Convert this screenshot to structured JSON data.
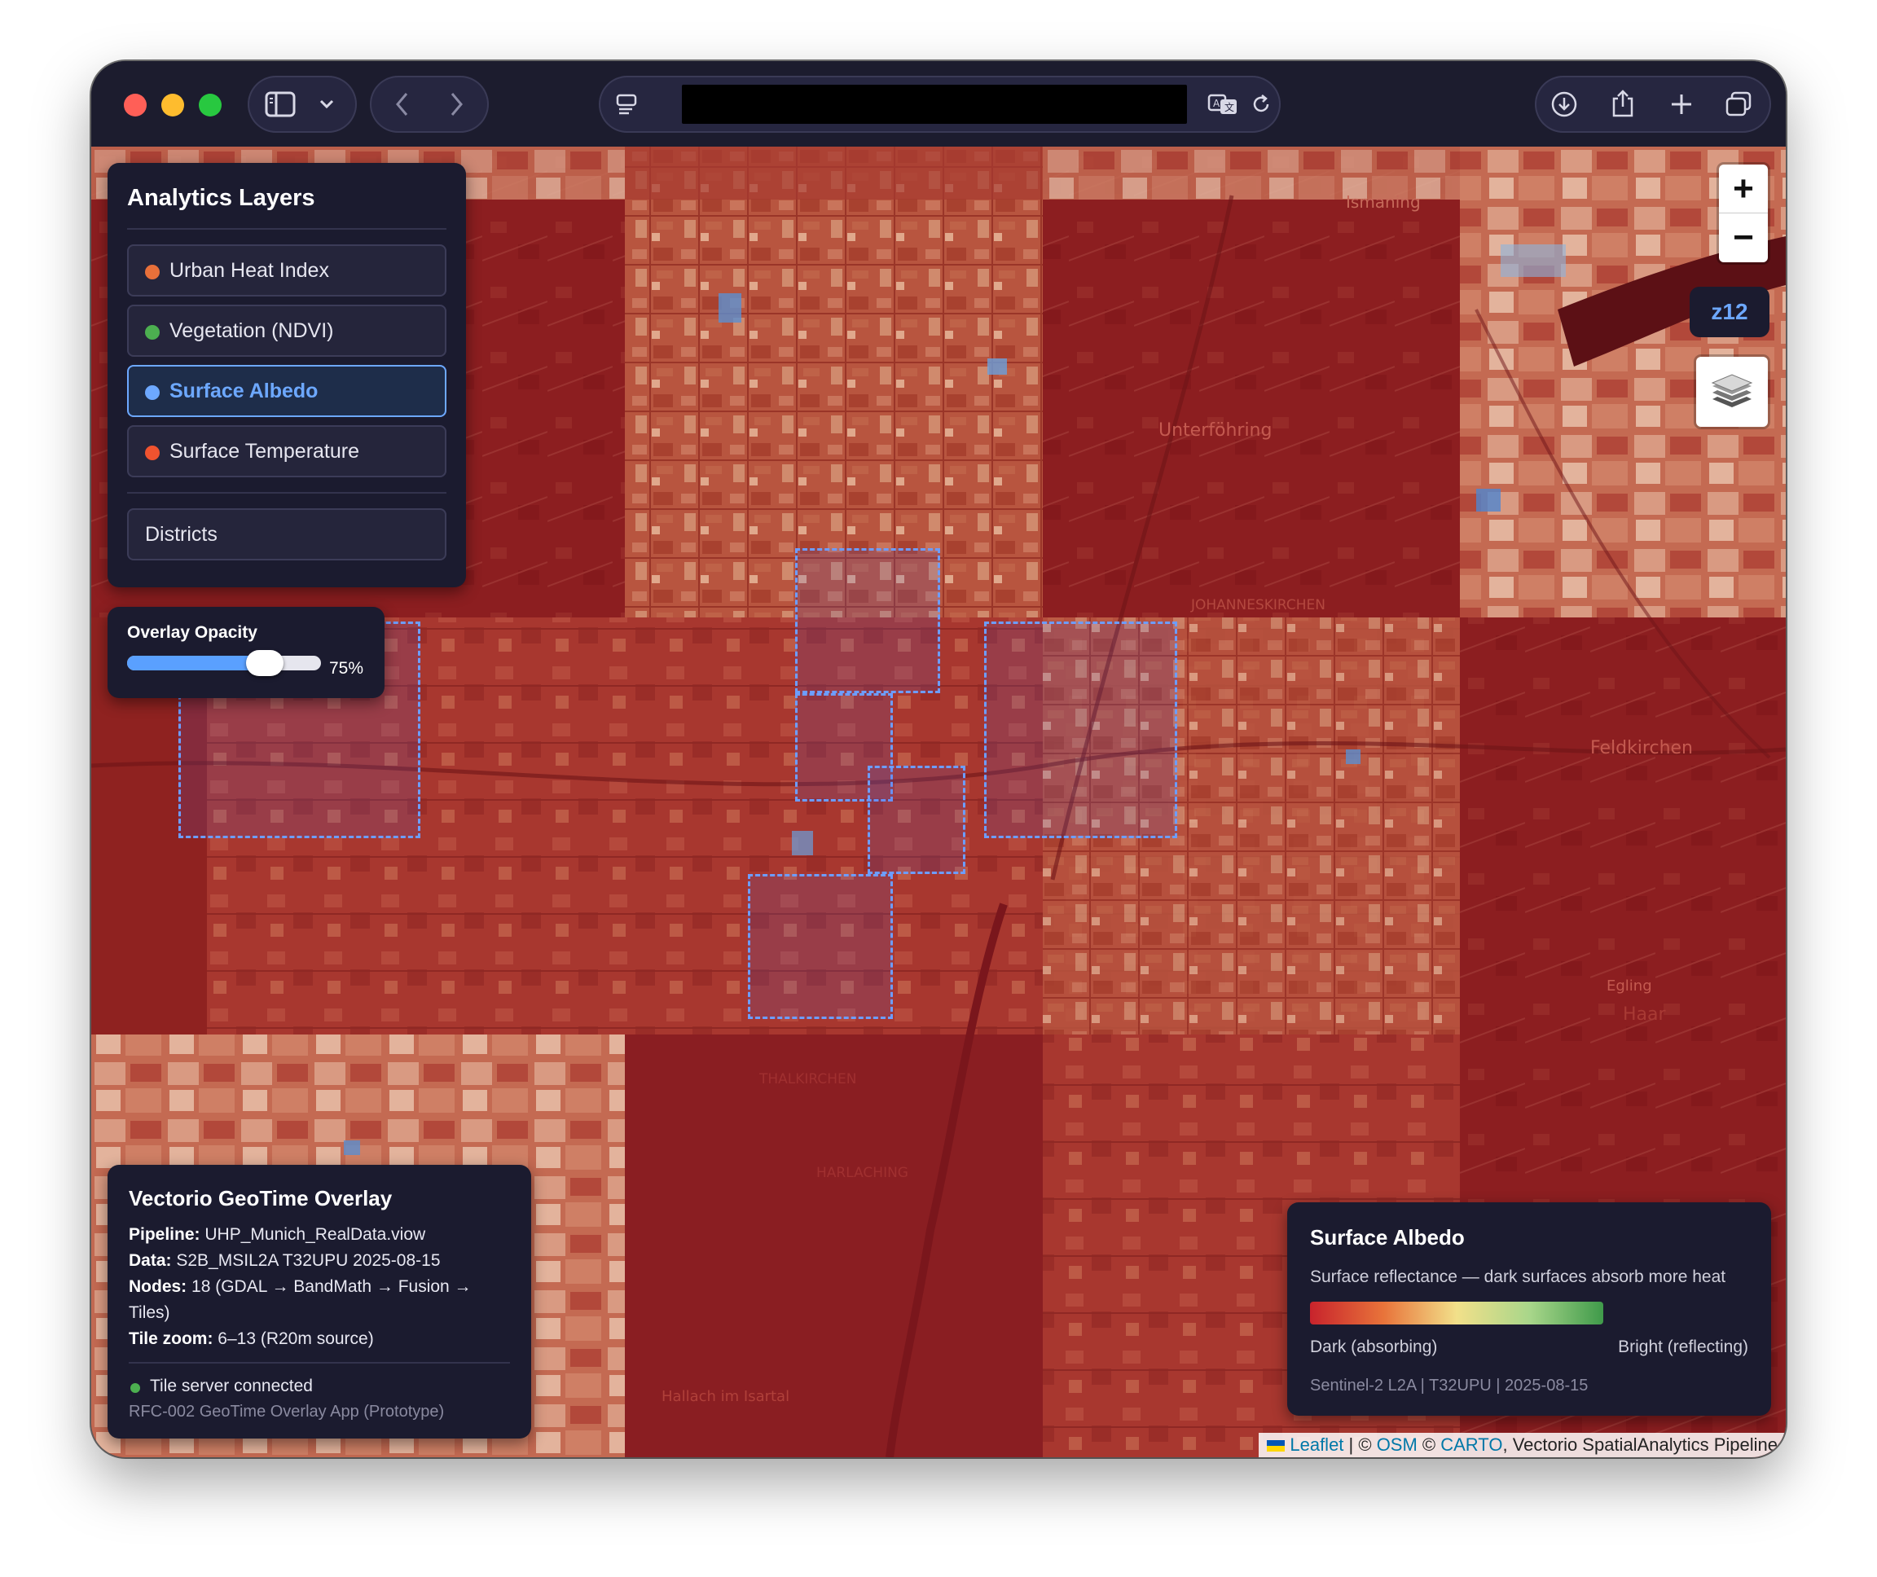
{
  "browser": {
    "url": "",
    "icons": [
      "sidebar-icon",
      "chevron-down-icon",
      "back-icon",
      "forward-icon",
      "site-info-icon",
      "translate-icon",
      "reload-icon",
      "download-icon",
      "share-icon",
      "new-tab-icon",
      "tabs-overview-icon"
    ]
  },
  "layers_panel": {
    "title": "Analytics Layers",
    "layers": [
      {
        "label": "Urban Heat Index",
        "color": "#e8703a",
        "active": false
      },
      {
        "label": "Vegetation (NDVI)",
        "color": "#4caf50",
        "active": false
      },
      {
        "label": "Surface Albedo",
        "color": "#6da8ff",
        "active": true
      },
      {
        "label": "Surface Temperature",
        "color": "#f0532f",
        "active": false
      }
    ],
    "districts_label": "Districts"
  },
  "opacity": {
    "label": "Overlay Opacity",
    "value_text": "75%",
    "value": 0.75
  },
  "map_controls": {
    "zoom_in": "+",
    "zoom_out": "−",
    "zoom_level": "z12"
  },
  "info_panel": {
    "title": "Vectorio GeoTime Overlay",
    "rows": [
      {
        "key": "Pipeline:",
        "value": "UHP_Munich_RealData.viow"
      },
      {
        "key": "Data:",
        "value": "S2B_MSIL2A T32UPU 2025-08-15"
      },
      {
        "key": "Nodes:",
        "value": "18 (GDAL → BandMath → Fusion → Tiles)"
      },
      {
        "key": "Tile zoom:",
        "value": "6–13 (R20m source)"
      }
    ],
    "status": "Tile server connected",
    "status_color": "#4caf50",
    "footer": "RFC-002 GeoTime Overlay App (Prototype)"
  },
  "legend": {
    "title": "Surface Albedo",
    "description": "Surface reflectance — dark surfaces absorb more heat",
    "gradient": [
      "#c8232c",
      "#e8733a",
      "#f2e08a",
      "#a8d68a",
      "#3f9a4a"
    ],
    "min_label": "Dark (absorbing)",
    "max_label": "Bright (reflecting)",
    "source": "Sentinel-2 L2A | T32UPU | 2025-08-15"
  },
  "attribution": {
    "leaflet": "Leaflet",
    "sep1": " | © ",
    "osm": "OSM",
    "sep2": " © ",
    "carto": "CARTO",
    "rest": ", Vectorio SpatialAnalytics Pipeline"
  },
  "map_labels": [
    "Unterföhring",
    "Feldkirchen",
    "Haar",
    "Egling",
    "JOHANNESKIRCHEN",
    "THALKIRCHEN",
    "HARLACHING",
    "Hallach im Isartal",
    "Ismaning"
  ]
}
